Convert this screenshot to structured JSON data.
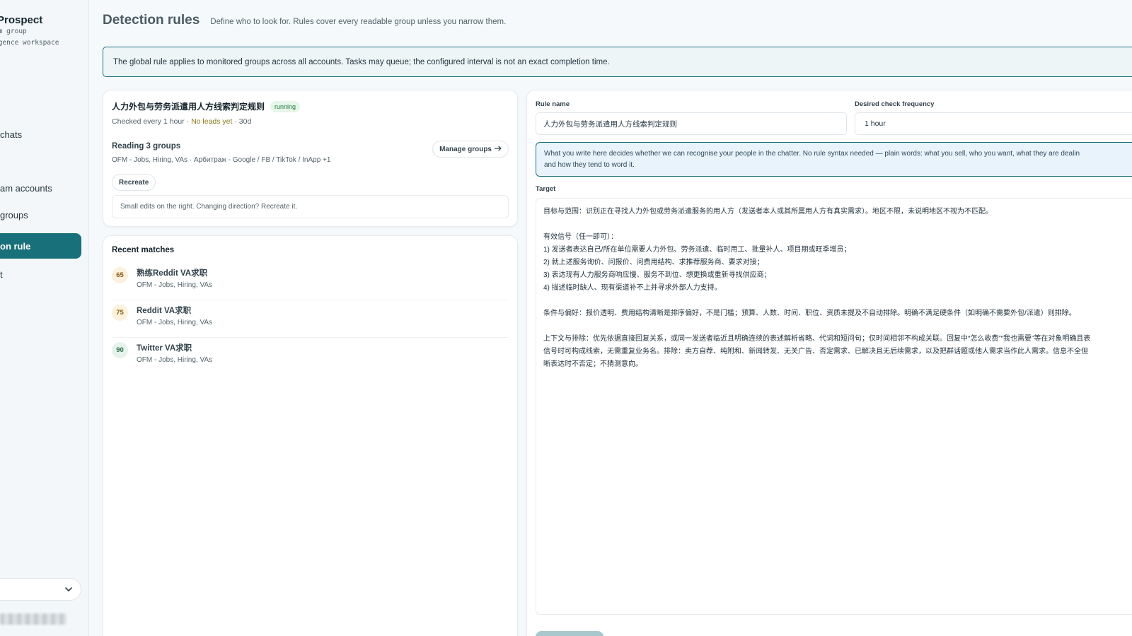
{
  "brand": {
    "title": "Prospect",
    "sub1": "am group",
    "sub2": "igence workspace"
  },
  "nav": [
    {
      "label": "chats"
    },
    {
      "label": "am accounts"
    },
    {
      "label": "groups"
    },
    {
      "label": "on rule"
    },
    {
      "label": "t"
    }
  ],
  "header": {
    "title": "Detection rules",
    "subtitle": "Define who to look for. Rules cover every readable group unless you narrow them."
  },
  "notice": "The global rule applies to monitored groups across all accounts. Tasks may queue; the configured interval is not an exact completion time.",
  "rule": {
    "title": "人力外包与劳务派遣用人方线索判定规则",
    "status": "running",
    "meta_prefix": "Checked every 1 hour · ",
    "meta_leads": "No leads yet",
    "meta_age": " · 30d",
    "reading_title": "Reading 3 groups",
    "reading_groups": "OFM - Jobs, Hiring, VAs · Арбитраж - Google / FB / TikTok / InApp +1",
    "manage_label": "Manage groups",
    "recreate_label": "Recreate",
    "hint": "Small edits on the right. Changing direction? Recreate it."
  },
  "matches": {
    "title": "Recent matches",
    "items": [
      {
        "score": "65",
        "name": "熟练Reddit VA求职",
        "group": "OFM - Jobs, Hiring, VAs"
      },
      {
        "score": "75",
        "name": "Reddit VA求职",
        "group": "OFM - Jobs, Hiring, VAs"
      },
      {
        "score": "90",
        "name": "Twitter VA求职",
        "group": "OFM - Jobs, Hiring, VAs"
      }
    ]
  },
  "editor": {
    "rule_name_label": "Rule name",
    "rule_name_value": "人力外包与劳务派遣用人方线索判定规则",
    "frequency_label": "Desired check frequency",
    "frequency_value": "1 hour",
    "info_line1": "What you write here decides whether we can recognise your people in the chatter. No rule syntax needed — plain words: what you sell, who you want, what they are dealin",
    "info_line2": "and how they tend to word it.",
    "target_label": "Target",
    "target_lines": [
      "目标与范围：识别正在寻找人力外包或劳务派遣服务的用人方（发送者本人或其所属用人方有真实需求）。地区不限，未说明地区不视为不匹配。",
      "",
      "有效信号（任一即可）：",
      "1) 发送者表达自己/所在单位需要人力外包、劳务派遣、临时用工、批量补人、项目期或旺季增员；",
      "2) 就上述服务询价、问报价、问费用结构、求推荐服务商、要求对接；",
      "3) 表达现有人力服务商响应慢、服务不到位、想更换或重新寻找供应商；",
      "4) 描述临时缺人、现有渠道补不上并寻求外部人力支持。",
      "",
      "条件与偏好：报价透明、费用结构清晰是排序偏好，不是门槛；预算、人数、时间、职位、资质未提及不自动排除。明确不满足硬条件（如明确不需要外包/派遣）则排除。",
      "",
      "上下文与排除：优先依据直接回复关系，或同一发送者临近且明确连续的表述解析省略、代词和短问句；仅时间相邻不构成关联。回复中“怎么收费”“我也需要”等在对象明确且表",
      "信号时可构成线索，无需重复业务名。排除：卖方自荐、纯附和、新闻转发、无关广告、否定需求、已解决且无后续需求，以及把群话题或他人需求当作此人需求。信息不全但",
      "晰表达时不否定；不猜测意向。"
    ]
  },
  "colors": {
    "accent": "#18707a",
    "score_65_bg": "#fbf1dc",
    "score_65_fg": "#8a5a12",
    "score_75_bg": "#fbf1dc",
    "score_75_fg": "#8a5a12",
    "score_90_bg": "#e6f3ec",
    "score_90_fg": "#2a6a45"
  }
}
